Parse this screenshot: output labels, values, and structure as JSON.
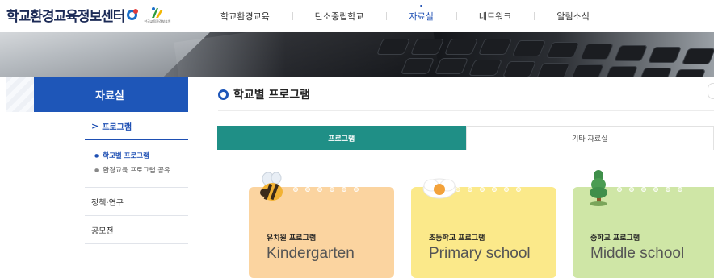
{
  "header": {
    "logo_text": "학교환경교육정보센터",
    "logo_caption": "한국교육환경보호원",
    "nav": [
      {
        "label": "학교환경교육",
        "active": false
      },
      {
        "label": "탄소중립학교",
        "active": false
      },
      {
        "label": "자료실",
        "active": true
      },
      {
        "label": "네트워크",
        "active": false
      },
      {
        "label": "알림소식",
        "active": false
      }
    ]
  },
  "sidebar": {
    "title": "자료실",
    "sections": [
      {
        "label": "프로그램",
        "arrow": ">",
        "sub": [
          {
            "label": "학교별 프로그램",
            "current": true
          },
          {
            "label": "환경교육 프로그램 공유",
            "current": false
          }
        ]
      },
      {
        "label": "정책·연구"
      },
      {
        "label": "공모전"
      }
    ]
  },
  "content": {
    "title": "학교별 프로그램",
    "tabs": [
      {
        "label": "프로그램",
        "active": true
      },
      {
        "label": "기타 자료실",
        "active": false
      }
    ],
    "cards": [
      {
        "kr": "유치원 프로그램",
        "en": "Kindergarten",
        "color": "#fbd4a0",
        "icon": "bee-icon"
      },
      {
        "kr": "초등학교 프로그램",
        "en": "Primary school",
        "color": "#fbe98a",
        "icon": "flower-icon"
      },
      {
        "kr": "중학교 프로그램",
        "en": "Middle school",
        "color": "#cfe6a6",
        "icon": "tree-icon"
      }
    ]
  },
  "colors": {
    "primary": "#1e56b8",
    "teal": "#1f8f86",
    "nav_active": "#1e4fb3"
  }
}
